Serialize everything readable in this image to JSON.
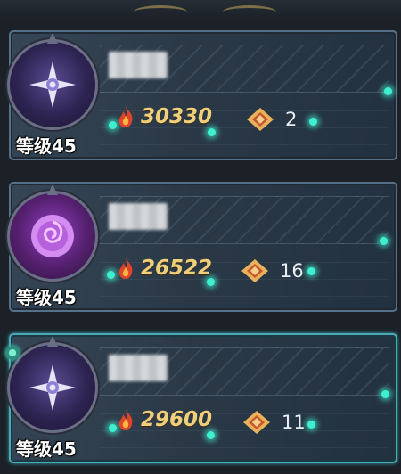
{
  "cards": [
    {
      "level": "等级45",
      "power": "30330",
      "count": "2",
      "emblem": "star-compass-icon",
      "active": false
    },
    {
      "level": "等级45",
      "power": "26522",
      "count": "16",
      "emblem": "rose-icon",
      "active": false
    },
    {
      "level": "等级45",
      "power": "29600",
      "count": "11",
      "emblem": "star-compass-icon",
      "active": true
    }
  ],
  "colors": {
    "power_text": "#f0cf7a",
    "accent_glow": "#3ff0d0",
    "panel": "#2b3947"
  }
}
